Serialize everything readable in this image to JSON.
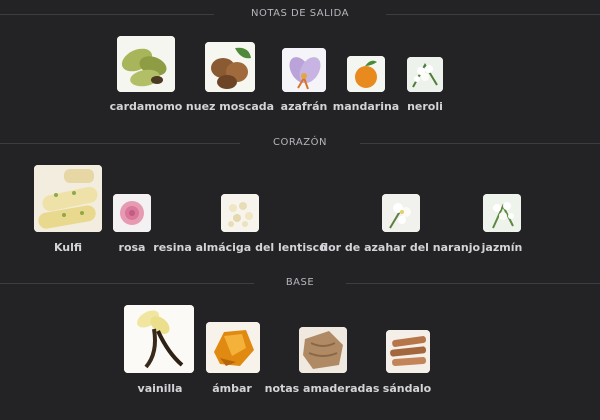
{
  "sections": {
    "top": {
      "title": "NOTAS DE SALIDA",
      "notes": [
        {
          "label": "cardamomo",
          "icon": "cardamom-image"
        },
        {
          "label": "nuez moscada",
          "icon": "nutmeg-image"
        },
        {
          "label": "azafrán",
          "icon": "saffron-image"
        },
        {
          "label": "mandarina",
          "icon": "mandarin-image"
        },
        {
          "label": "neroli",
          "icon": "neroli-image"
        }
      ]
    },
    "heart": {
      "title": "CORAZÓN",
      "notes": [
        {
          "label": "Kulfi",
          "icon": "kulfi-image"
        },
        {
          "label": "rosa",
          "icon": "rose-image"
        },
        {
          "label": "resina almáciga del lentisco",
          "icon": "mastic-resin-image"
        },
        {
          "label": "flor de azahar del naranjo",
          "icon": "orange-blossom-image"
        },
        {
          "label": "jazmín",
          "icon": "jasmine-image"
        }
      ]
    },
    "base": {
      "title": "BASE",
      "notes": [
        {
          "label": "vainilla",
          "icon": "vanilla-image"
        },
        {
          "label": "ámbar",
          "icon": "amber-image"
        },
        {
          "label": "notas amaderadas",
          "icon": "woody-notes-image"
        },
        {
          "label": "sándalo",
          "icon": "sandalwood-image"
        }
      ]
    }
  }
}
